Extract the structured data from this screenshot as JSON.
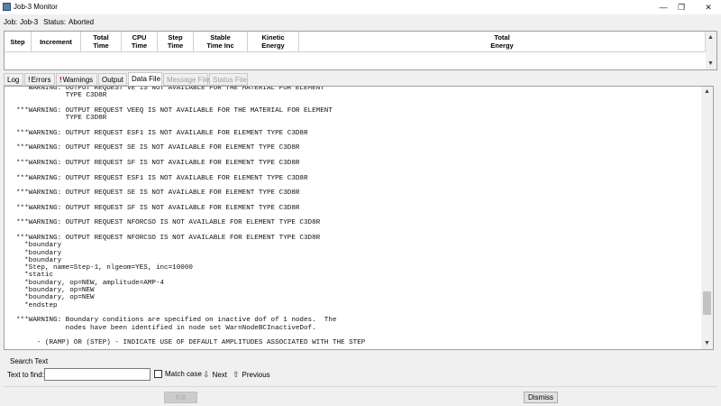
{
  "window": {
    "title": "Job-3 Monitor",
    "minimize": "—",
    "restore": "❐",
    "close": "✕"
  },
  "job": {
    "job_label": "Job:",
    "job_value": "Job-3",
    "status_label": "Status:",
    "status_value": "Aborted"
  },
  "table": {
    "columns": [
      "Step",
      "Increment",
      "Total\nTime",
      "CPU\nTime",
      "Step\nTime",
      "Stable\nTime Inc",
      "Kinetic\nEnergy",
      "Total\nEnergy"
    ]
  },
  "tabs": [
    {
      "label": "Log",
      "bang": "",
      "state": "normal"
    },
    {
      "label": "Errors",
      "bang": "!",
      "state": "normal"
    },
    {
      "label": "Warnings",
      "bang": "!",
      "state": "normal"
    },
    {
      "label": "Output",
      "bang": "",
      "state": "normal"
    },
    {
      "label": "Data File",
      "bang": "",
      "state": "active"
    },
    {
      "label": "Message File",
      "bang": "",
      "state": "disabled"
    },
    {
      "label": "Status File",
      "bang": "",
      "state": "disabled"
    }
  ],
  "log_text": "***WARNING: OUTPUT REQUEST VE IS NOT AVAILABLE FOR THE MATERIAL FOR ELEMENT\n            TYPE C3D8R\n\n***WARNING: OUTPUT REQUEST VEEQ IS NOT AVAILABLE FOR THE MATERIAL FOR ELEMENT\n            TYPE C3D8R\n\n***WARNING: OUTPUT REQUEST ESF1 IS NOT AVAILABLE FOR ELEMENT TYPE C3D8R\n\n***WARNING: OUTPUT REQUEST SE IS NOT AVAILABLE FOR ELEMENT TYPE C3D8R\n\n***WARNING: OUTPUT REQUEST SF IS NOT AVAILABLE FOR ELEMENT TYPE C3D8R\n\n***WARNING: OUTPUT REQUEST ESF1 IS NOT AVAILABLE FOR ELEMENT TYPE C3D8R\n\n***WARNING: OUTPUT REQUEST SE IS NOT AVAILABLE FOR ELEMENT TYPE C3D8R\n\n***WARNING: OUTPUT REQUEST SF IS NOT AVAILABLE FOR ELEMENT TYPE C3D8R\n\n***WARNING: OUTPUT REQUEST NFORCSO IS NOT AVAILABLE FOR ELEMENT TYPE C3D8R\n\n***WARNING: OUTPUT REQUEST NFORCSO IS NOT AVAILABLE FOR ELEMENT TYPE C3D8R\n  *boundary\n  *boundary\n  *boundary\n  *Step, name=Step-1, nlgeom=YES, inc=10000\n  *static\n  *boundary, op=NEW, amplitude=AMP-4\n  *boundary, op=NEW\n  *boundary, op=NEW\n  *endstep\n\n***WARNING: Boundary conditions are specified on inactive dof of 1 nodes.  The\n            nodes have been identified in node set WarnNodeBCInactiveDof.\n\n     - (RAMP) OR (STEP) - INDICATE USE OF DEFAULT AMPLITUDES ASSOCIATED WITH THE STEP",
  "search": {
    "title": "Search Text",
    "label": "Text to find:",
    "value": "",
    "match_case": "Match case",
    "next": "Next",
    "previous": "Previous"
  },
  "buttons": {
    "kill": "Kill",
    "dismiss": "Dismiss"
  },
  "icons": {
    "next": "arrow-down-icon",
    "previous": "arrow-up-icon"
  }
}
